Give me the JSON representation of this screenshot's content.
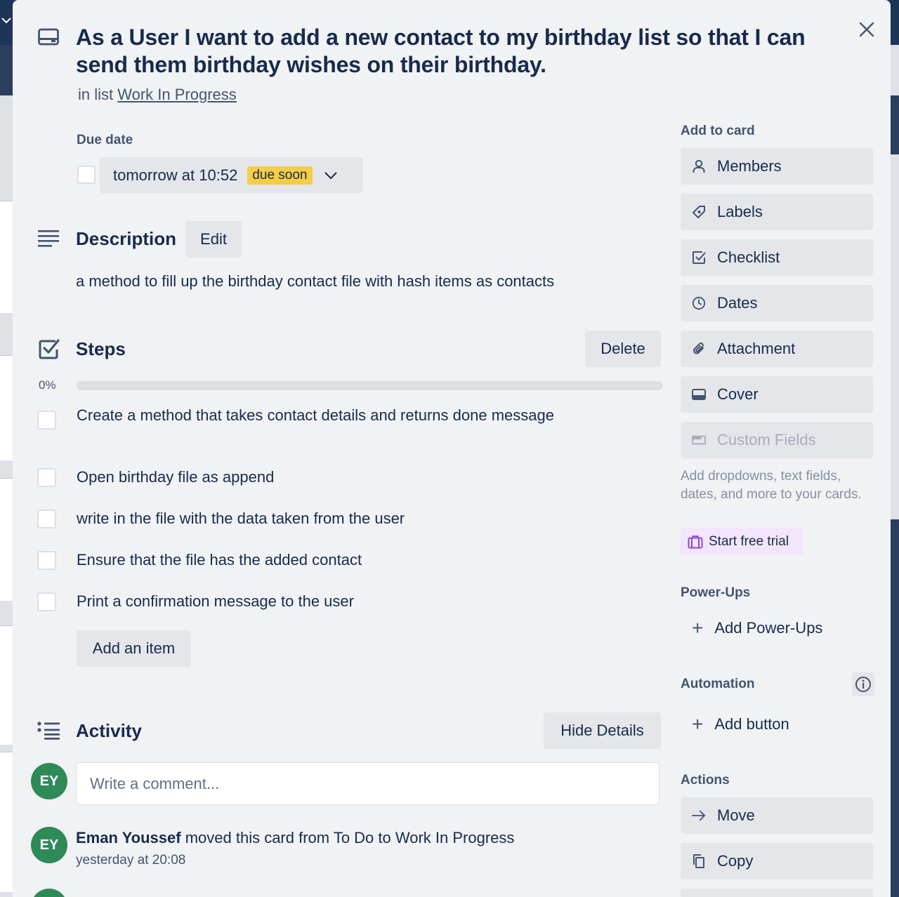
{
  "card": {
    "title": "As a User I want to add a new contact to my birthday list so that I can send them birthday wishes on their birthday.",
    "in_list_prefix": "in list",
    "list_name": "Work In Progress"
  },
  "due": {
    "label": "Due date",
    "value": "tomorrow at 10:52",
    "badge": "due soon"
  },
  "description": {
    "title": "Description",
    "edit_label": "Edit",
    "text": "a method to fill up the birthday contact file with hash items as contacts"
  },
  "checklist": {
    "title": "Steps",
    "delete_label": "Delete",
    "progress_text": "0%",
    "progress": 0,
    "items": [
      "Create a method that takes contact details and returns done message",
      "Open birthday file as append",
      "write in the file with the data taken from the user",
      "Ensure that the file has the added contact",
      "Print a confirmation message to the user"
    ],
    "add_item_label": "Add an item"
  },
  "activity": {
    "title": "Activity",
    "hide_details_label": "Hide Details",
    "comment_placeholder": "Write a comment...",
    "avatar_initials": "EY",
    "entries": [
      {
        "user": "Eman Youssef",
        "action": "moved this card from To Do to Work In Progress",
        "time": "yesterday at 20:08"
      }
    ]
  },
  "sidebar": {
    "add_to_card_label": "Add to card",
    "buttons": [
      {
        "label": "Members",
        "icon": "person-icon"
      },
      {
        "label": "Labels",
        "icon": "tag-icon"
      },
      {
        "label": "Checklist",
        "icon": "checkbox-icon"
      },
      {
        "label": "Dates",
        "icon": "clock-icon"
      },
      {
        "label": "Attachment",
        "icon": "paperclip-icon"
      },
      {
        "label": "Cover",
        "icon": "card-icon"
      },
      {
        "label": "Custom Fields",
        "icon": "fields-icon"
      }
    ],
    "custom_fields_desc": "Add dropdowns, text fields, dates, and more to your cards.",
    "trial_label": "Start free trial",
    "power_ups_label": "Power-Ups",
    "add_power_ups_label": "Add Power-Ups",
    "automation_label": "Automation",
    "add_button_label": "Add button",
    "actions_label": "Actions",
    "actions": [
      {
        "label": "Move",
        "icon": "arrow-right-icon"
      },
      {
        "label": "Copy",
        "icon": "copy-icon"
      }
    ]
  },
  "colors": {
    "modal_bg": "#f1f2f4",
    "button_bg": "#e4e6ea",
    "badge_yellow": "#f5cd47",
    "avatar_green": "#2e8a57",
    "text_primary": "#172b4d",
    "text_secondary": "#44546f"
  }
}
